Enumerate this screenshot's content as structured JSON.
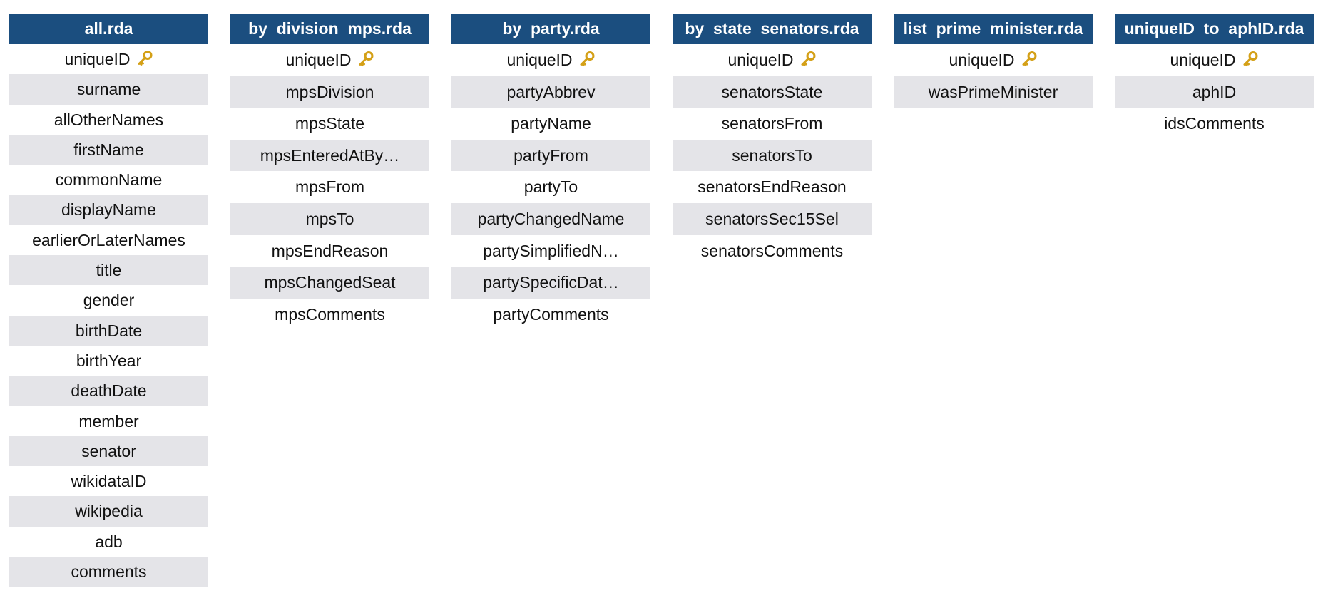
{
  "tables": [
    {
      "title": "all.rda",
      "fields": [
        {
          "name": "uniqueID",
          "key": true
        },
        {
          "name": "surname"
        },
        {
          "name": "allOtherNames"
        },
        {
          "name": "firstName"
        },
        {
          "name": "commonName"
        },
        {
          "name": "displayName"
        },
        {
          "name": "earlierOrLaterNames"
        },
        {
          "name": "title"
        },
        {
          "name": "gender"
        },
        {
          "name": "birthDate"
        },
        {
          "name": "birthYear"
        },
        {
          "name": "deathDate"
        },
        {
          "name": "member"
        },
        {
          "name": "senator"
        },
        {
          "name": "wikidataID"
        },
        {
          "name": "wikipedia"
        },
        {
          "name": "adb"
        },
        {
          "name": "comments"
        }
      ]
    },
    {
      "title": "by_division_mps.rda",
      "fields": [
        {
          "name": "uniqueID",
          "key": true
        },
        {
          "name": "mpsDivision"
        },
        {
          "name": "mpsState"
        },
        {
          "name": "mpsEnteredAtBy…"
        },
        {
          "name": "mpsFrom"
        },
        {
          "name": "mpsTo"
        },
        {
          "name": "mpsEndReason"
        },
        {
          "name": "mpsChangedSeat"
        },
        {
          "name": "mpsComments"
        }
      ]
    },
    {
      "title": "by_party.rda",
      "fields": [
        {
          "name": "uniqueID",
          "key": true
        },
        {
          "name": "partyAbbrev"
        },
        {
          "name": "partyName"
        },
        {
          "name": "partyFrom"
        },
        {
          "name": "partyTo"
        },
        {
          "name": "partyChangedName"
        },
        {
          "name": "partySimplifiedN…"
        },
        {
          "name": "partySpecificDat…"
        },
        {
          "name": "partyComments"
        }
      ]
    },
    {
      "title": "by_state_senators.rda",
      "fields": [
        {
          "name": "uniqueID",
          "key": true
        },
        {
          "name": "senatorsState"
        },
        {
          "name": "senatorsFrom"
        },
        {
          "name": "senatorsTo"
        },
        {
          "name": "senatorsEndReason"
        },
        {
          "name": "senatorsSec15Sel"
        },
        {
          "name": "senatorsComments"
        }
      ]
    },
    {
      "title": "list_prime_minister.rda",
      "fields": [
        {
          "name": "uniqueID",
          "key": true
        },
        {
          "name": "wasPrimeMinister"
        }
      ]
    },
    {
      "title": "uniqueID_to_aphID.rda",
      "fields": [
        {
          "name": "uniqueID",
          "key": true
        },
        {
          "name": "aphID"
        },
        {
          "name": "idsComments"
        }
      ]
    }
  ],
  "colors": {
    "header_bg": "#1b4e7f",
    "header_text": "#ffffff",
    "row_alt_bg": "#e4e4e8",
    "key_icon": "#d4a017"
  },
  "key_icon_name": "key-icon"
}
